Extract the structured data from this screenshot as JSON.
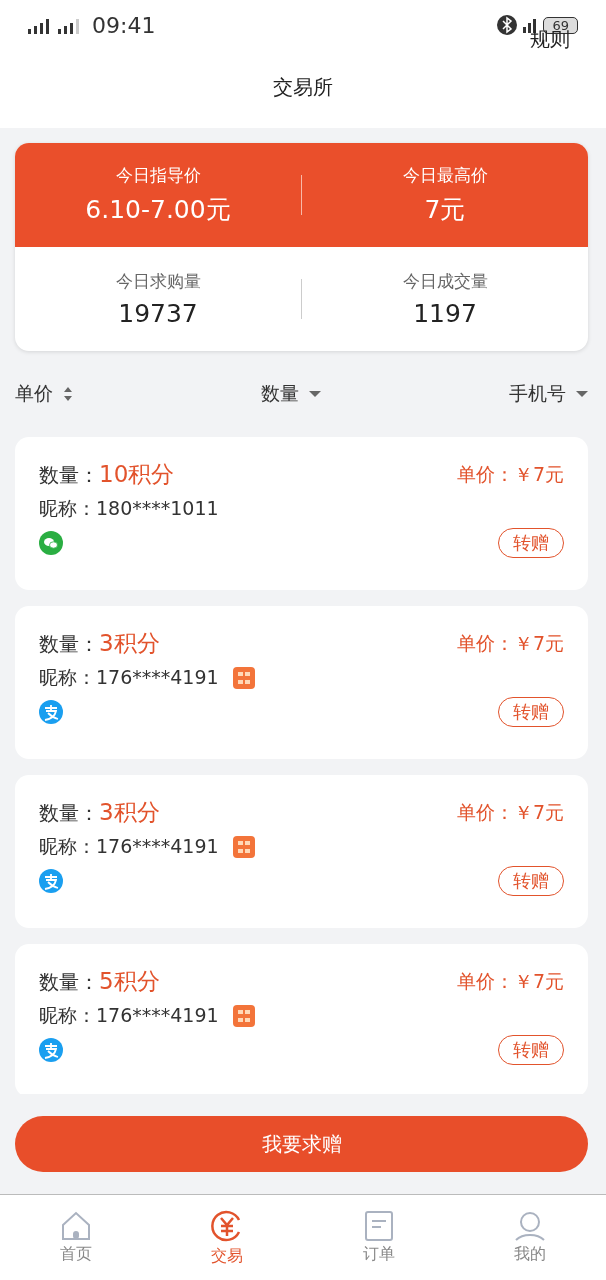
{
  "status_bar": {
    "time": "09:41",
    "battery": "69"
  },
  "header": {
    "title": "交易所",
    "rules_link": "规则"
  },
  "stats": {
    "top": [
      {
        "label": "今日指导价",
        "value": "6.10-7.00元"
      },
      {
        "label": "今日最高价",
        "value": "7元"
      }
    ],
    "bottom": [
      {
        "label": "今日求购量",
        "value": "19737"
      },
      {
        "label": "今日成交量",
        "value": "1197"
      }
    ]
  },
  "sort_bar": [
    {
      "label": "单价",
      "kind": "both"
    },
    {
      "label": "数量",
      "kind": "down"
    },
    {
      "label": "手机号",
      "kind": "down"
    }
  ],
  "listings": [
    {
      "quantity_label": "数量：",
      "quantity": "10积分",
      "nickname_label": "昵称：",
      "nickname": "180****1011",
      "price": "单价：￥7元",
      "kind": "wechat",
      "gold_badge": false,
      "action": "转赠"
    },
    {
      "quantity_label": "数量：",
      "quantity": "3积分",
      "nickname_label": "昵称：",
      "nickname": "176****4191",
      "price": "单价：￥7元",
      "kind": "alipay",
      "gold_badge": true,
      "action": "转赠"
    },
    {
      "quantity_label": "数量：",
      "quantity": "3积分",
      "nickname_label": "昵称：",
      "nickname": "176****4191",
      "price": "单价：￥7元",
      "kind": "alipay",
      "gold_badge": true,
      "action": "转赠"
    },
    {
      "quantity_label": "数量：",
      "quantity": "5积分",
      "nickname_label": "昵称：",
      "nickname": "176****4191",
      "price": "单价：￥7元",
      "kind": "alipay",
      "gold_badge": true,
      "action": "转赠"
    }
  ],
  "request_button": "我要求赠",
  "tab_bar": [
    {
      "label": "首页",
      "kind": "home",
      "selected": false
    },
    {
      "label": "交易",
      "kind": "trade",
      "selected": true
    },
    {
      "label": "订单",
      "kind": "orders",
      "selected": false
    },
    {
      "label": "我的",
      "kind": "profile",
      "selected": false
    }
  ]
}
